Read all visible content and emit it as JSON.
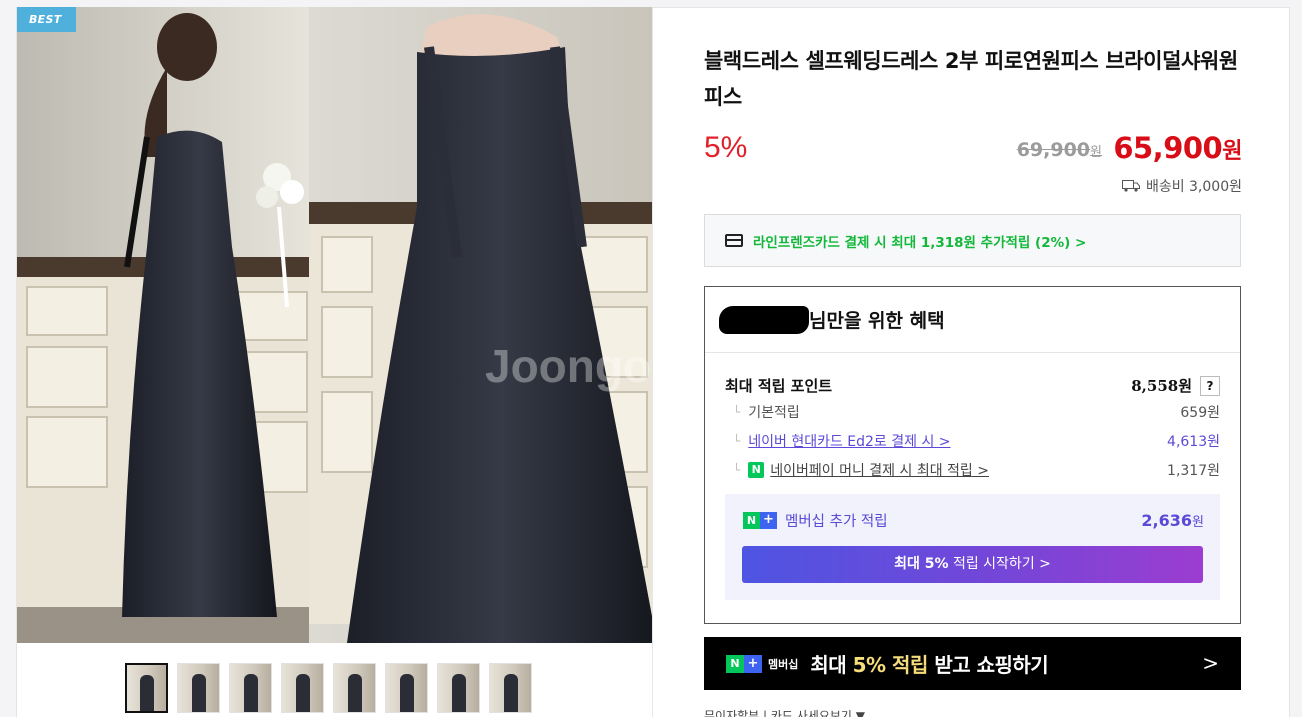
{
  "gallery": {
    "badge": "BEST",
    "thumb_count": 8
  },
  "product": {
    "title": "블랙드레스 셀프웨딩드레스 2부 피로연원피스 브라이덜샤워원피스",
    "discount": "5%",
    "original_price": "69,900",
    "original_price_unit": "원",
    "sale_price": "65,900",
    "sale_price_unit": "원",
    "shipping": "배송비 3,000원"
  },
  "card_promo": {
    "text": "라인프렌즈카드 결제 시 최대 1,318원 추가적립 (2%) >"
  },
  "benefit": {
    "header_suffix": "님만을 위한 혜택",
    "max_points_label": "최대 적립 포인트",
    "max_points_value": "8,558원",
    "help": "?",
    "rows": [
      {
        "label": "기본적립",
        "value": "659원"
      },
      {
        "label": "네이버 현대카드 Ed2로 결제 시 >",
        "value": "4,613원"
      },
      {
        "label": "네이버페이 머니 결제 시 최대 적립 >",
        "value": "1,317원"
      }
    ],
    "npay_badge": "N",
    "member": {
      "label": "멤버십 추가 적립",
      "value": "2,636",
      "unit": "원",
      "button_bold": "최대 5%",
      "button_rest": " 적립 시작하기 >"
    }
  },
  "banner": {
    "tag": "멤버십",
    "text_pre": "최대 ",
    "text_highlight": "5% 적립",
    "text_post": " 받고 쇼핑하기",
    "chevron": ">"
  },
  "bottom_text": "무이자할부 | 카드 사세요보기 ▼",
  "colors": {
    "discount_red": "#e1222c",
    "price_red": "#d80d17",
    "naver_green": "#03c75a",
    "member_purple": "#5b4ad8",
    "badge_blue": "#4fb0db"
  }
}
